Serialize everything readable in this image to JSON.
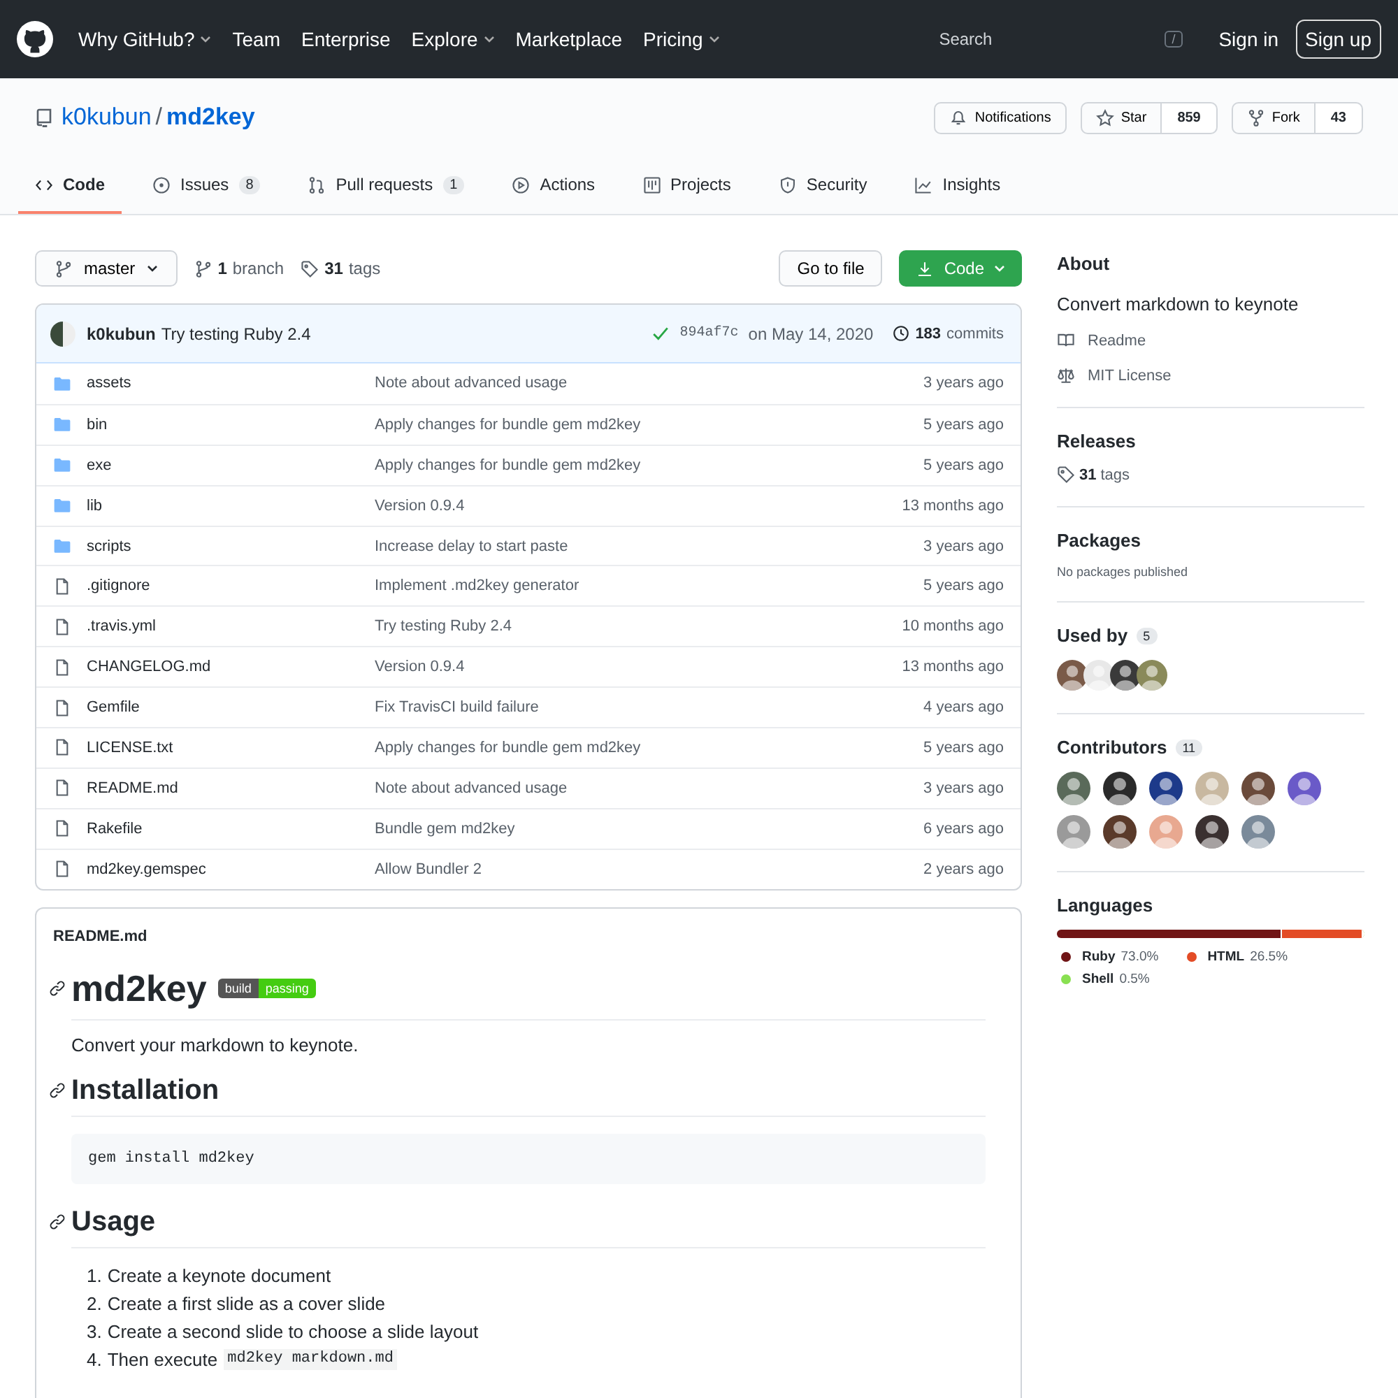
{
  "header": {
    "nav": [
      {
        "label": "Why GitHub?",
        "dropdown": true
      },
      {
        "label": "Team",
        "dropdown": false
      },
      {
        "label": "Enterprise",
        "dropdown": false
      },
      {
        "label": "Explore",
        "dropdown": true
      },
      {
        "label": "Marketplace",
        "dropdown": false
      },
      {
        "label": "Pricing",
        "dropdown": true
      }
    ],
    "search": {
      "placeholder": "Search",
      "shortcut": "/"
    },
    "buttons": [
      {
        "label": "Sign in",
        "kind": "link"
      },
      {
        "label": "Sign up",
        "kind": "outlined"
      }
    ]
  },
  "repo": {
    "owner": "k0kubun",
    "separator": "/",
    "name": "md2key",
    "actions": [
      {
        "label": "Notifications",
        "kind": "bell"
      },
      {
        "label": "Star",
        "kind": "star",
        "count": "859"
      },
      {
        "label": "Fork",
        "kind": "fork",
        "count": "43"
      }
    ]
  },
  "tabs": [
    {
      "label": "Code",
      "kind": "code",
      "selected": true
    },
    {
      "label": "Issues",
      "kind": "issue",
      "count": "8",
      "selected": false
    },
    {
      "label": "Pull requests",
      "kind": "pr",
      "count": "1",
      "selected": false
    },
    {
      "label": "Actions",
      "kind": "play",
      "selected": false
    },
    {
      "label": "Projects",
      "kind": "project",
      "selected": false
    },
    {
      "label": "Security",
      "kind": "shield",
      "selected": false
    },
    {
      "label": "Insights",
      "kind": "graph",
      "selected": false
    }
  ],
  "toolbar": {
    "branch": "master",
    "branches_count": "1",
    "branches_label": "branch",
    "tags_count": "31",
    "tags_label": "tags",
    "go_to_file": "Go to file",
    "code_button": "Code"
  },
  "commit": {
    "author": "k0kubun",
    "message": "Try testing Ruby 2.4",
    "sha": "894af7c",
    "date": "on May 14, 2020",
    "commits_count": "183",
    "commits_label": "commits"
  },
  "files": [
    {
      "kind": "folder",
      "name": "assets",
      "message": "Note about advanced usage",
      "age": "3 years ago"
    },
    {
      "kind": "folder",
      "name": "bin",
      "message": "Apply changes for bundle gem md2key",
      "age": "5 years ago"
    },
    {
      "kind": "folder",
      "name": "exe",
      "message": "Apply changes for bundle gem md2key",
      "age": "5 years ago"
    },
    {
      "kind": "folder",
      "name": "lib",
      "message": "Version 0.9.4",
      "age": "13 months ago"
    },
    {
      "kind": "folder",
      "name": "scripts",
      "message": "Increase delay to start paste",
      "age": "3 years ago"
    },
    {
      "kind": "file",
      "name": ".gitignore",
      "message": "Implement .md2key generator",
      "age": "5 years ago"
    },
    {
      "kind": "file",
      "name": ".travis.yml",
      "message": "Try testing Ruby 2.4",
      "age": "10 months ago"
    },
    {
      "kind": "file",
      "name": "CHANGELOG.md",
      "message": "Version 0.9.4",
      "age": "13 months ago"
    },
    {
      "kind": "file",
      "name": "Gemfile",
      "message": "Fix TravisCI build failure",
      "age": "4 years ago"
    },
    {
      "kind": "file",
      "name": "LICENSE.txt",
      "message": "Apply changes for bundle gem md2key",
      "age": "5 years ago"
    },
    {
      "kind": "file",
      "name": "README.md",
      "message": "Note about advanced usage",
      "age": "3 years ago"
    },
    {
      "kind": "file",
      "name": "Rakefile",
      "message": "Bundle gem md2key",
      "age": "6 years ago"
    },
    {
      "kind": "file",
      "name": "md2key.gemspec",
      "message": "Allow Bundler 2",
      "age": "2 years ago"
    }
  ],
  "readme": {
    "filename": "README.md",
    "title": "md2key",
    "badge": {
      "left": "build",
      "right": "passing"
    },
    "blocks": [
      {
        "kind": "p",
        "text": "Convert your markdown to keynote."
      },
      {
        "kind": "h2",
        "text": "Installation"
      },
      {
        "kind": "code",
        "text": "gem install md2key"
      },
      {
        "kind": "h2",
        "text": "Usage"
      },
      {
        "kind": "ol",
        "items": [
          {
            "number": "1.",
            "text": "Create a keynote document"
          },
          {
            "number": "2.",
            "text": "Create a first slide as a cover slide"
          },
          {
            "number": "3.",
            "text": "Create a second slide to choose a slide layout"
          },
          {
            "number": "4.",
            "text": "Then execute",
            "code": "md2key markdown.md"
          }
        ]
      }
    ]
  },
  "sidebar": {
    "about": {
      "title": "About",
      "description": "Convert markdown to keynote",
      "links": [
        {
          "kind": "book",
          "label": "Readme"
        },
        {
          "kind": "scale",
          "label": "MIT License"
        }
      ]
    },
    "releases": {
      "title": "Releases",
      "count": "31",
      "label": "tags"
    },
    "packages": {
      "title": "Packages",
      "text": "No packages published"
    },
    "used_by": {
      "title": "Used by",
      "count": "5",
      "avatars": [
        {
          "color": "#7a5a48"
        },
        {
          "color": "#e8e8e8"
        },
        {
          "color": "#3a3a3a"
        },
        {
          "color": "#8a8a5a"
        }
      ]
    },
    "contributors": {
      "title": "Contributors",
      "count": "11",
      "avatars": [
        {
          "color": "#5a6a5a"
        },
        {
          "color": "#2a2a2a"
        },
        {
          "color": "#1d3a8a"
        },
        {
          "color": "#c8b8a0"
        },
        {
          "color": "#6a4a3a"
        },
        {
          "color": "#6a5ac8"
        },
        {
          "color": "#9a9a9a"
        },
        {
          "color": "#5a3a2a"
        },
        {
          "color": "#e8a890"
        },
        {
          "color": "#3a3030"
        },
        {
          "color": "#7a8a9a"
        }
      ]
    },
    "languages": {
      "title": "Languages",
      "items": [
        {
          "name": "Ruby",
          "percent": "73.0%",
          "level": 0.73,
          "color": "#701516"
        },
        {
          "name": "HTML",
          "percent": "26.5%",
          "level": 0.265,
          "color": "#e34c26"
        },
        {
          "name": "Shell",
          "percent": "0.5%",
          "level": 0.005,
          "color": "#89e051"
        }
      ]
    }
  }
}
